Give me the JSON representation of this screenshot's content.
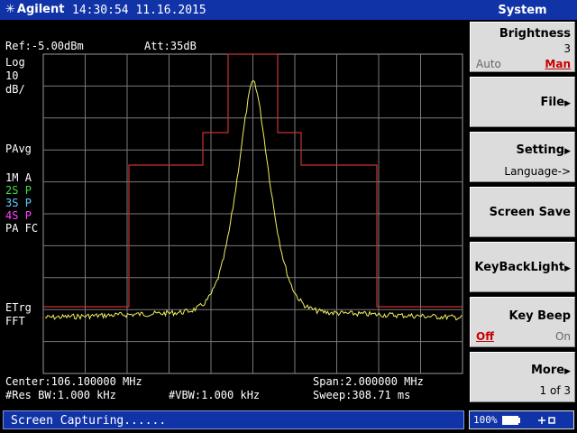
{
  "header": {
    "brand": "Agilent",
    "datetime": "14:30:54 11.16.2015",
    "menu_title": "System"
  },
  "screen": {
    "ref_level": "Ref:-5.00dBm",
    "attenuation": "Att:35dB",
    "scale_type": "Log",
    "scale_value": "10",
    "scale_unit": "dB/",
    "avg_mode": "PAvg",
    "traces": [
      {
        "label": "1M",
        "mode": "A",
        "color": "#ffffff"
      },
      {
        "label": "2S",
        "mode": "P",
        "color": "#44dd44"
      },
      {
        "label": "3S",
        "mode": "P",
        "color": "#66ccff"
      },
      {
        "label": "4S",
        "mode": "P",
        "color": "#ff44ff"
      }
    ],
    "pa_fc": "PA FC",
    "trigger": "ETrg",
    "fft": "FFT",
    "center": "Center:106.100000 MHz",
    "span": "Span:2.000000 MHz",
    "res_bw": "#Res BW:1.000 kHz",
    "vbw": "#VBW:1.000 kHz",
    "sweep": "Sweep:308.71 ms"
  },
  "softkeys": {
    "brightness": {
      "label": "Brightness",
      "value": "3",
      "opt_auto": "Auto",
      "opt_man": "Man"
    },
    "file": {
      "label": "File"
    },
    "setting": {
      "label": "Setting",
      "sub": "Language->"
    },
    "screen_save": {
      "label": "Screen Save"
    },
    "keybacklight": {
      "label": "KeyBackLight"
    },
    "key_beep": {
      "label": "Key Beep",
      "opt_off": "Off",
      "opt_on": "On"
    },
    "more": {
      "label": "More",
      "sub": "1 of 3"
    }
  },
  "status": {
    "message": "Screen Capturing......",
    "battery_percent": "100%"
  },
  "colors": {
    "bar_blue": "#1133a8",
    "trace_yellow": "#f0f060",
    "mask_red": "#c83232",
    "grid": "#7a7a7a",
    "selected_red": "#c80000"
  }
}
